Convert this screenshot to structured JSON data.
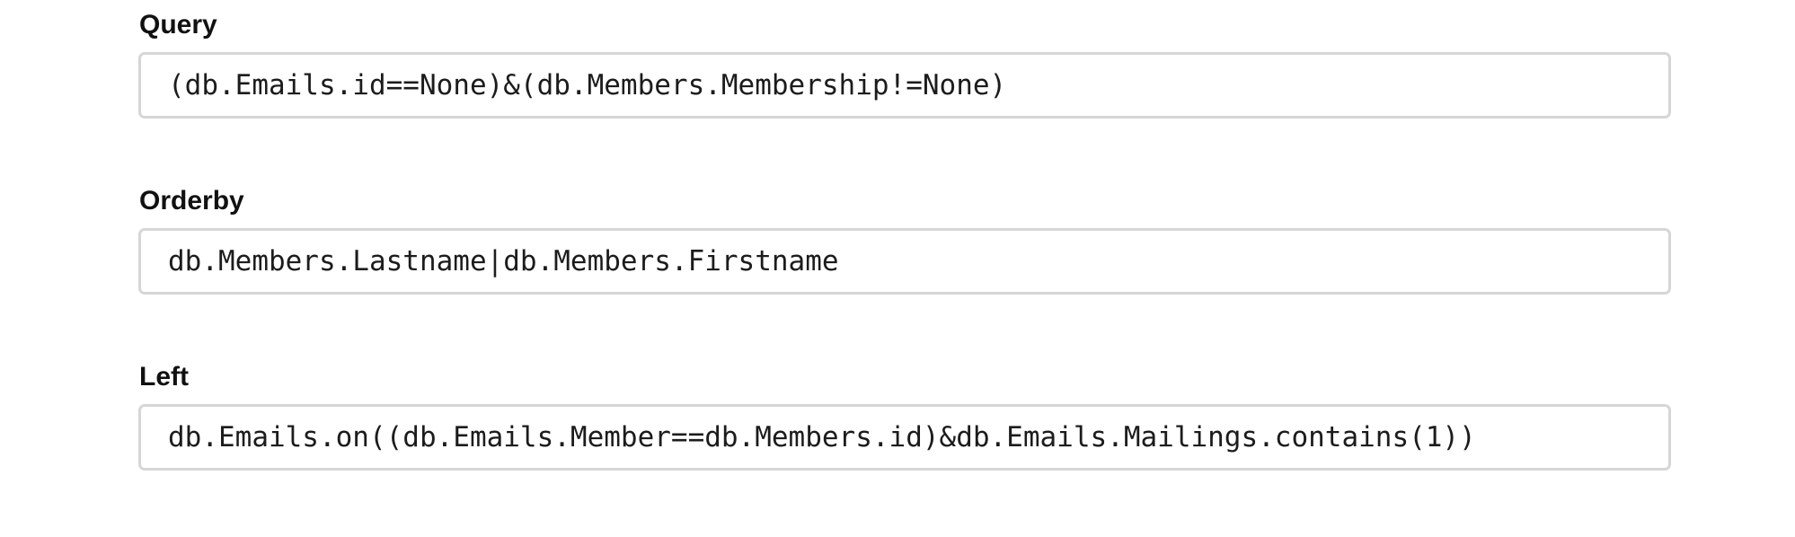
{
  "form": {
    "fields": [
      {
        "label": "Query",
        "value": "(db.Emails.id==None)&(db.Members.Membership!=None)"
      },
      {
        "label": "Orderby",
        "value": "db.Members.Lastname|db.Members.Firstname"
      },
      {
        "label": "Left",
        "value": "db.Emails.on((db.Emails.Member==db.Members.id)&db.Emails.Mailings.contains(1))"
      }
    ]
  }
}
